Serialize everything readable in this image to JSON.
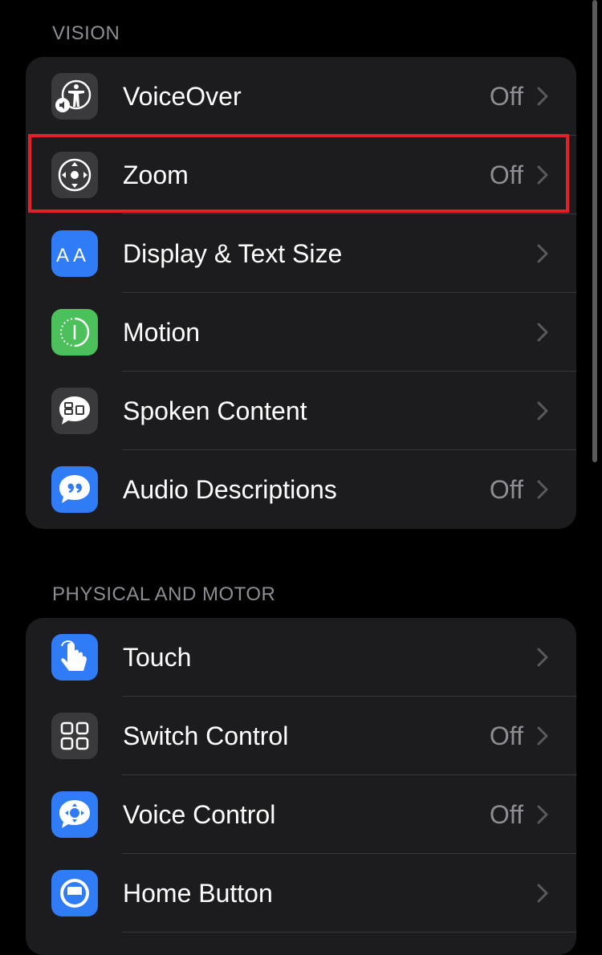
{
  "sections": [
    {
      "header": "VISION",
      "rows": [
        {
          "label": "VoiceOver",
          "value": "Off",
          "icon": "voiceover-icon",
          "icon_bg": "#3a3a3c"
        },
        {
          "label": "Zoom",
          "value": "Off",
          "icon": "zoom-icon",
          "icon_bg": "#3a3a3c"
        },
        {
          "label": "Display & Text Size",
          "value": "",
          "icon": "text-size-icon",
          "icon_bg": "#2f7cf6"
        },
        {
          "label": "Motion",
          "value": "",
          "icon": "motion-icon",
          "icon_bg": "#4cc05b"
        },
        {
          "label": "Spoken Content",
          "value": "",
          "icon": "spoken-content-icon",
          "icon_bg": "#3a3a3c"
        },
        {
          "label": "Audio Descriptions",
          "value": "Off",
          "icon": "audio-descriptions-icon",
          "icon_bg": "#2f7cf6"
        }
      ]
    },
    {
      "header": "PHYSICAL AND MOTOR",
      "rows": [
        {
          "label": "Touch",
          "value": "",
          "icon": "touch-icon",
          "icon_bg": "#2f7cf6"
        },
        {
          "label": "Switch Control",
          "value": "Off",
          "icon": "switch-control-icon",
          "icon_bg": "#3a3a3c"
        },
        {
          "label": "Voice Control",
          "value": "Off",
          "icon": "voice-control-icon",
          "icon_bg": "#2f7cf6"
        },
        {
          "label": "Home Button",
          "value": "",
          "icon": "home-button-icon",
          "icon_bg": "#2f7cf6"
        }
      ]
    }
  ],
  "highlight_color": "#e3202a"
}
